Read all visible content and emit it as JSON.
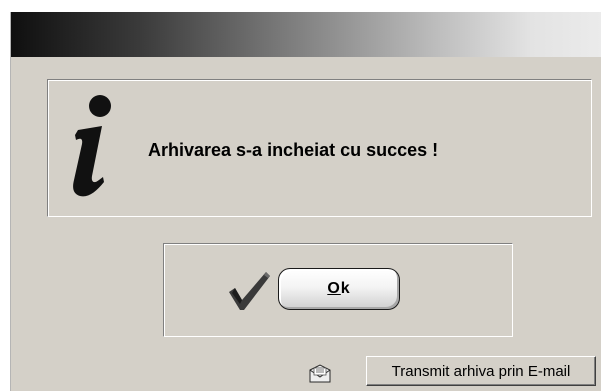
{
  "dialog": {
    "message": "Arhivarea s-a incheiat cu succes !",
    "message_icon": "info-icon",
    "ok_button": {
      "accelerator": "O",
      "rest": "k",
      "icon": "checkmark-icon"
    },
    "email_button": {
      "label": "Transmit arhiva prin E-mail",
      "icon": "email-icon"
    }
  },
  "colors": {
    "dialog_bg": "#d4d0c8",
    "title_gradient_start": "#0f0f0f",
    "title_gradient_end": "#ebebeb",
    "checkmark": "#3a3a3a"
  }
}
